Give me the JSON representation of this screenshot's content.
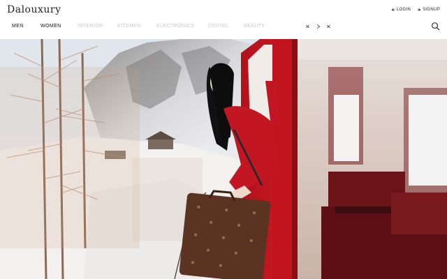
{
  "brand": {
    "logo_text": "Dalouxury"
  },
  "auth": {
    "login_label": "LOGIN",
    "signup_label": "SIGNUP"
  },
  "nav": {
    "items": [
      {
        "label": "MEN",
        "state": "active"
      },
      {
        "label": "WOMEN",
        "state": "active"
      },
      {
        "label": "INTERIOR",
        "state": "dim"
      },
      {
        "label": "KITCHEN",
        "state": "dim"
      },
      {
        "label": "ELECTRONICS",
        "state": "dim"
      },
      {
        "label": "DIGITAL",
        "state": "dim"
      },
      {
        "label": "BEAUTY",
        "state": "dim"
      }
    ]
  },
  "carousel_controls": {
    "icons": [
      "close-icon",
      "chevron-right-icon",
      "close-icon"
    ]
  },
  "search": {
    "icon": "search-icon"
  },
  "hero": {
    "description_icon": "hero-image"
  },
  "colors": {
    "accent": "#c3141f",
    "text": "#111111",
    "muted": "#c8c8c8"
  }
}
